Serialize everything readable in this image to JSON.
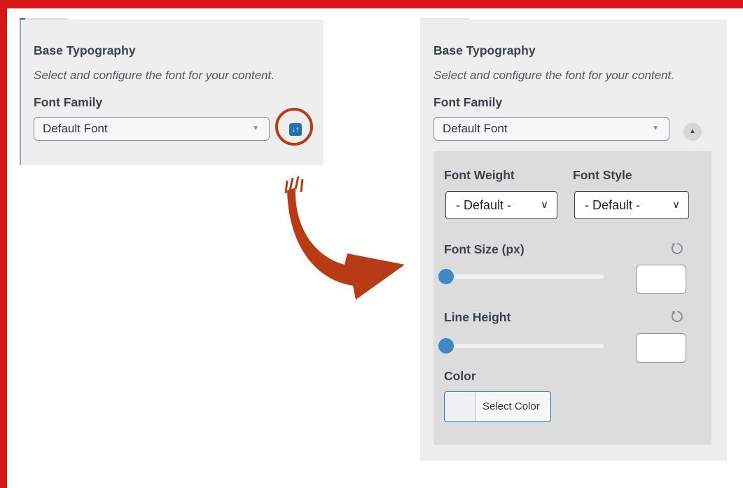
{
  "left_panel": {
    "title": "Base Typography",
    "description": "Select and configure the font for your content.",
    "font_family_label": "Font Family",
    "font_family_value": "Default Font",
    "toggle_icon": "sort-arrows-icon"
  },
  "right_panel": {
    "title": "Base Typography",
    "description": "Select and configure the font for your content.",
    "font_family_label": "Font Family",
    "font_family_value": "Default Font",
    "collapse_icon": "triangle-up-icon",
    "font_weight_label": "Font Weight",
    "font_weight_value": "- Default -",
    "font_style_label": "Font Style",
    "font_style_value": "- Default -",
    "font_size_label": "Font Size (px)",
    "font_size_value": "",
    "line_height_label": "Line Height",
    "line_height_value": "",
    "color_label": "Color",
    "select_color_label": "Select Color"
  },
  "colors": {
    "frame": "#d7161c",
    "accent": "#2271b1",
    "highlight": "#b73b14",
    "slider_thumb": "#3f87c5"
  }
}
